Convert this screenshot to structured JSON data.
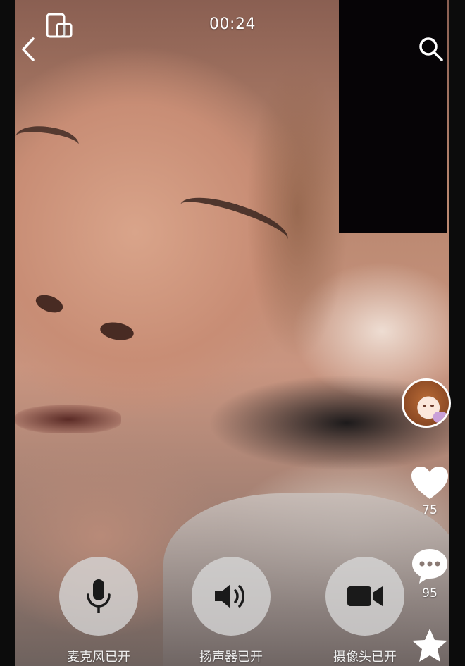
{
  "header": {
    "timer": "00:24",
    "back_icon": "chevron-left-icon",
    "minimize_icon": "floating-window-icon",
    "search_icon": "search-icon"
  },
  "side_actions": {
    "avatar_icon": "anime-avatar",
    "likes": {
      "icon": "heart-icon",
      "count": "75"
    },
    "comments": {
      "icon": "comment-bubble-icon",
      "count": "95"
    },
    "favorite": {
      "icon": "star-icon"
    }
  },
  "call_controls": [
    {
      "icon": "microphone-icon",
      "label": "麦克风已开"
    },
    {
      "icon": "speaker-icon",
      "label": "扬声器已开"
    },
    {
      "icon": "video-camera-icon",
      "label": "摄像头已开"
    }
  ],
  "colors": {
    "control_bg": "#d7d7d7",
    "icon_dark": "#1a1a1a",
    "text_light": "#ffffff",
    "pip_bg": "#060406"
  }
}
